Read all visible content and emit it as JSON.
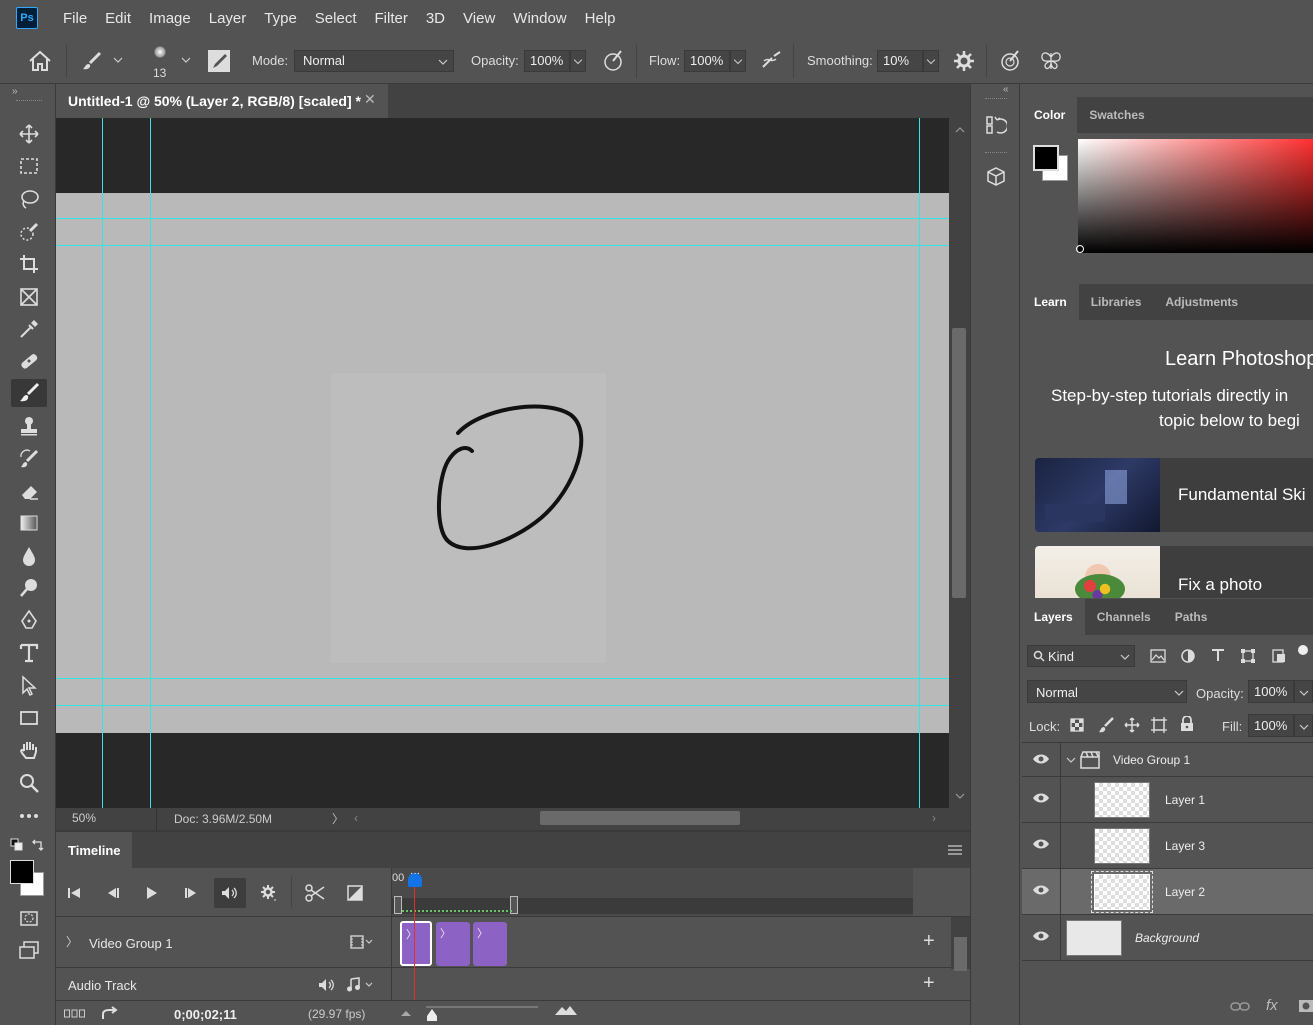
{
  "app": {
    "logo": "Ps"
  },
  "menu": [
    "File",
    "Edit",
    "Image",
    "Layer",
    "Type",
    "Select",
    "Filter",
    "3D",
    "View",
    "Window",
    "Help"
  ],
  "options": {
    "brush_size": "13",
    "mode_label": "Mode:",
    "mode_value": "Normal",
    "opacity_label": "Opacity:",
    "opacity_value": "100%",
    "flow_label": "Flow:",
    "flow_value": "100%",
    "smoothing_label": "Smoothing:",
    "smoothing_value": "10%"
  },
  "document": {
    "tab_title": "Untitled-1 @ 50% (Layer 2, RGB/8) [scaled] *",
    "zoom": "50%",
    "doc_info": "Doc: 3.96M/2.50M"
  },
  "timeline": {
    "tab": "Timeline",
    "playhead_label": "00",
    "video_group": "Video Group 1",
    "audio_track": "Audio Track",
    "timecode": "0;00;02;11",
    "fps": "(29.97 fps)"
  },
  "color_panel": {
    "tabs": [
      "Color",
      "Swatches"
    ]
  },
  "learn_panel": {
    "tabs": [
      "Learn",
      "Libraries",
      "Adjustments"
    ],
    "heading": "Learn Photoshop",
    "subtitle_line1": "Step-by-step tutorials directly in",
    "subtitle_line2": "topic below to begi",
    "cards": [
      "Fundamental Ski",
      "Fix a photo"
    ]
  },
  "layers_panel": {
    "tabs": [
      "Layers",
      "Channels",
      "Paths"
    ],
    "filter_kind": "Kind",
    "blend_mode": "Normal",
    "opacity_label": "Opacity:",
    "opacity_value": "100%",
    "lock_label": "Lock:",
    "fill_label": "Fill:",
    "fill_value": "100%",
    "group": "Video Group 1",
    "layers": [
      "Layer 1",
      "Layer 3",
      "Layer 2"
    ],
    "background": "Background"
  },
  "colors": {
    "accent": "#31a8ff",
    "guide": "#35e5e5",
    "clip": "#8c62c4",
    "playhead": "#e0302d"
  }
}
